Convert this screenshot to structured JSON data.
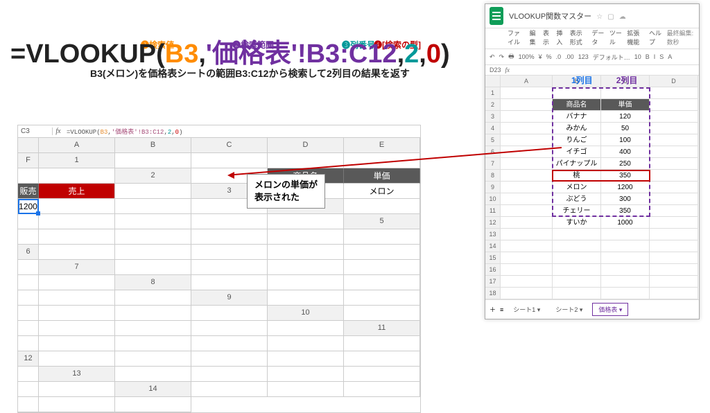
{
  "arg_labels": {
    "l1": "❶検索値",
    "l2": "❷検索範囲",
    "l3": "❸列番号",
    "l4": "❹[検索の型]"
  },
  "formula_parts": {
    "p0": "=VLOOKUP(",
    "p1": "B3",
    "comma1": ",",
    "p2": "'価格表'!B3:C12",
    "comma2": ",",
    "p3": "2",
    "comma3": ",",
    "p4": "0",
    "p5": ")"
  },
  "explanation": "B3(メロン)を価格表シートの範囲B3:C12から検索して2列目の結果を返す",
  "sheet1": {
    "active_cell": "C3",
    "fx_parts": {
      "pre": "=VLOOKUP(",
      "a": "B3",
      "b": "'価格表'!B3:C12",
      "c": "2",
      "d": "0",
      "post": ")"
    },
    "col_headers": [
      "A",
      "B",
      "C",
      "D",
      "E",
      "F"
    ],
    "row_count": 14,
    "header_row": {
      "B": "商品名",
      "C": "単価",
      "D": "販売個数",
      "E": "売上"
    },
    "data_row": {
      "B": "メロン",
      "C": "1200"
    }
  },
  "callout": {
    "line1": "メロンの単価が",
    "line2": "表示された"
  },
  "sheet2": {
    "title": "VLOOKUP関数マスター",
    "menus": [
      "ファイル",
      "編集",
      "表示",
      "挿入",
      "表示形式",
      "データ",
      "ツール",
      "拡張機能",
      "ヘルプ"
    ],
    "menu_right": "最終編集: 数秒",
    "toolbar": [
      "↶",
      "↷",
      "🖶",
      "100%",
      "¥",
      "%",
      ".0",
      ".00",
      "123",
      "デフォルト…",
      "10",
      "B",
      "I",
      "S",
      "A"
    ],
    "fx_label": "D23",
    "col_headers": [
      "A",
      "B",
      "C",
      "D"
    ],
    "row_count": 18,
    "collabels": [
      "1列目",
      "2列目"
    ],
    "header": {
      "B": "商品名",
      "C": "単価"
    },
    "rows": [
      {
        "B": "バナナ",
        "C": "120"
      },
      {
        "B": "みかん",
        "C": "50"
      },
      {
        "B": "りんご",
        "C": "100"
      },
      {
        "B": "イチゴ",
        "C": "400"
      },
      {
        "B": "パイナップル",
        "C": "250"
      },
      {
        "B": "桃",
        "C": "350"
      },
      {
        "B": "メロン",
        "C": "1200"
      },
      {
        "B": "ぶどう",
        "C": "300"
      },
      {
        "B": "チェリー",
        "C": "350"
      },
      {
        "B": "すいか",
        "C": "1000"
      }
    ],
    "tabs": {
      "sheet1": "シート1",
      "sheet2": "シート2",
      "active": "価格表"
    }
  }
}
